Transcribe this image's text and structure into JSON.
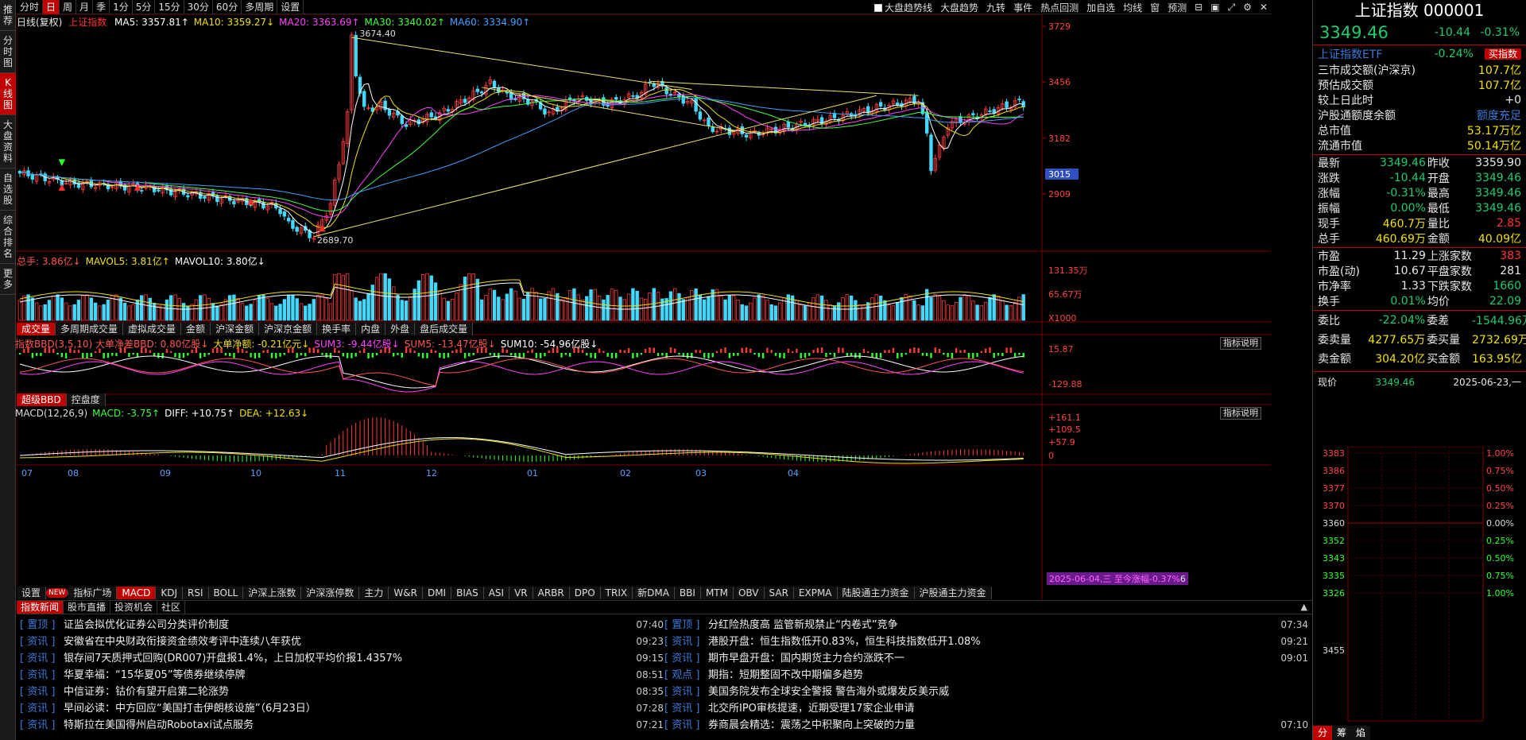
{
  "left_tabs": [
    "推荐",
    "分时图",
    "K线图",
    "大盘资料",
    "自选股",
    "综合排名",
    "更多"
  ],
  "left_active": 2,
  "toolbar": {
    "periods": [
      "分时",
      "日",
      "周",
      "月",
      "季",
      "1分",
      "5分",
      "15分",
      "30分",
      "60分",
      "多周期",
      "设置"
    ],
    "active": 1,
    "right": [
      "大盘趋势线",
      "大盘趋势",
      "九转",
      "事件",
      "热点回测",
      "加自选",
      "均线",
      "窗",
      "预测"
    ],
    "window_controls": [
      "⊟",
      "▣",
      "⤢",
      "⚙",
      "✕"
    ]
  },
  "kline": {
    "header": "日线(复权)",
    "name": "上证指数",
    "ma": [
      {
        "l": "MA5: 3357.81↑",
        "c": "#ffffff"
      },
      {
        "l": "MA10: 3359.27↓",
        "c": "#f0e000"
      },
      {
        "l": "MA20: 3363.69↑",
        "c": "#ff40ff"
      },
      {
        "l": "MA30: 3340.02↑",
        "c": "#40ff40"
      },
      {
        "l": "MA60: 3334.90↑",
        "c": "#40a0ff"
      }
    ],
    "yticks": [
      "3729",
      "3456",
      "3182",
      "2909"
    ],
    "current_label": "3015",
    "high_label": "3674.40",
    "low_label": "2689.70"
  },
  "volume": {
    "header": [
      {
        "l": "总手: 3.86亿↓",
        "c": "#ff5555"
      },
      {
        "l": "MAVOL5: 3.81亿↑",
        "c": "#f0e000"
      },
      {
        "l": "MAVOL10: 3.80亿↓",
        "c": "#ffffff"
      }
    ],
    "yticks": [
      "131.35万",
      "65.67万",
      "X1000"
    ],
    "tabs": [
      "成交量",
      "多周期成交量",
      "虚拟成交量",
      "金额",
      "沪深金额",
      "沪深京金额",
      "换手率",
      "内盘",
      "外盘",
      "盘后成交量"
    ]
  },
  "bbd": {
    "header": [
      {
        "l": "指数BBD(3,5,10) 大单净差BBD: 0.80亿股↓",
        "c": "#ff5555"
      },
      {
        "l": "大单净额: -0.21亿元↓",
        "c": "#f0e000"
      },
      {
        "l": "SUM3: -9.44亿股↓",
        "c": "#ff40ff"
      },
      {
        "l": "SUM5: -13.47亿股↓",
        "c": "#ff5555"
      },
      {
        "l": "SUM10: -54.96亿股↓",
        "c": "#ffffff"
      }
    ],
    "yticks": [
      "15.87",
      "-129.88"
    ],
    "explain": "指标说明",
    "tabs": [
      "超级BBD",
      "控盘度"
    ]
  },
  "macd": {
    "header": [
      {
        "l": "MACD(12,26,9)",
        "c": "#dddddd"
      },
      {
        "l": "MACD: -3.75↑",
        "c": "#40ff40"
      },
      {
        "l": "DIFF: +10.75↑",
        "c": "#ffffff"
      },
      {
        "l": "DEA: +12.63↓",
        "c": "#f0e000"
      }
    ],
    "yticks": [
      "+161.1",
      "+109.5",
      "+57.9",
      "0"
    ],
    "explain": "指标说明",
    "months": [
      "07",
      "08",
      "09",
      "10",
      "11",
      "12",
      "01",
      "02",
      "03",
      "04"
    ],
    "tooltip": "2025-06-04,三 至今涨幅-0.37%",
    "tooltip_tail": "6"
  },
  "indicator_tabs": [
    "设置",
    "指标广场",
    "MACD",
    "KDJ",
    "RSI",
    "BOLL",
    "沪深上涨数",
    "沪深涨停数",
    "主力",
    "W&R",
    "DMI",
    "BIAS",
    "ASI",
    "VR",
    "ARBR",
    "DPO",
    "TRIX",
    "新DMA",
    "BBI",
    "MTM",
    "OBV",
    "SAR",
    "EXPMA",
    "陆股通主力资金",
    "沪股通主力资金"
  ],
  "indicator_new": "NEW",
  "news": {
    "tabs": [
      "指数新闻",
      "股市直播",
      "投资机会",
      "社区"
    ],
    "left": [
      {
        "tag": "[ 置顶 ]",
        "text": "证监会拟优化证券公司分类评价制度",
        "time": "07:40"
      },
      {
        "tag": "[ 资讯 ]",
        "text": "安徽省在中央财政衔接资金绩效考评中连续八年获优",
        "time": "09:23"
      },
      {
        "tag": "[ 资讯 ]",
        "text": "银存间7天质押式回购(DR007)开盘报1.4%，上日加权平均价报1.4357%",
        "time": "09:15"
      },
      {
        "tag": "[ 资讯 ]",
        "text": "华夏幸福：“15华夏05”等债券继续停牌",
        "time": "08:51"
      },
      {
        "tag": "[ 资讯 ]",
        "text": "中信证券：钴价有望开启第二轮涨势",
        "time": "08:35"
      },
      {
        "tag": "[ 资讯 ]",
        "text": "早间必读：中方回应“美国打击伊朗核设施”（6月23日）",
        "time": "07:28"
      },
      {
        "tag": "[ 资讯 ]",
        "text": "特斯拉在美国得州启动Robotaxi试点服务",
        "time": "07:21"
      }
    ],
    "right": [
      {
        "tag": "[ 置顶 ]",
        "text": "分红险热度高 监管新规禁止“内卷式”竞争",
        "time": "07:34"
      },
      {
        "tag": "[ 资讯 ]",
        "text": "港股开盘：恒生指数低开0.83%，恒生科技指数低开1.08%",
        "time": "09:21"
      },
      {
        "tag": "[ 资讯 ]",
        "text": "期市早盘开盘：国内期货主力合约涨跌不一",
        "time": "09:01"
      },
      {
        "tag": "[ 观点 ]",
        "text": "期指：短期整固不改中期偏多趋势",
        "time": ""
      },
      {
        "tag": "[ 资讯 ]",
        "text": "美国务院发布全球安全警报 警告海外或爆发反美示威",
        "time": ""
      },
      {
        "tag": "[ 资讯 ]",
        "text": "北交所IPO审核提速，近期受理17家企业申请",
        "time": ""
      },
      {
        "tag": "[ 资讯 ]",
        "text": "券商晨会精选：震荡之中积聚向上突破的力量",
        "time": "07:10"
      }
    ]
  },
  "quote": {
    "title": "上证指数 000001",
    "price": "3349.46",
    "change": "-10.44",
    "pct": "-0.31%",
    "etf": {
      "name": "上证指数ETF",
      "pct": "-0.24%",
      "btn": "买指数"
    },
    "list1": [
      [
        "三市成交额(沪深京)",
        "107.7亿"
      ],
      [
        "预估成交额",
        "107.7亿"
      ],
      [
        "较上日此时",
        "+0"
      ],
      [
        "沪股通额度余额",
        "额度充足"
      ],
      [
        "总市值",
        "53.17万亿"
      ],
      [
        "流通市值",
        "50.14万亿"
      ]
    ],
    "grid": [
      [
        "最新",
        "3349.46",
        "昨收",
        "3359.90"
      ],
      [
        "涨跌",
        "-10.44",
        "开盘",
        "3349.46"
      ],
      [
        "涨幅",
        "-0.31%",
        "最高",
        "3349.46"
      ],
      [
        "振幅",
        "0.00%",
        "最低",
        "3349.46"
      ],
      [
        "现手",
        "460.7万",
        "量比",
        "2.85"
      ],
      [
        "总手",
        "460.69万",
        "金额",
        "40.09亿"
      ]
    ],
    "grid2": [
      [
        "市盈",
        "11.29",
        "上涨家数",
        "383"
      ],
      [
        "市盈(动)",
        "10.67",
        "平盘家数",
        "281"
      ],
      [
        "市净率",
        "1.33",
        "下跌家数",
        "1660"
      ],
      [
        "换手",
        "0.01%",
        "均价",
        "22.09"
      ]
    ],
    "wb": [
      [
        "委比",
        "-22.04%",
        "委差",
        "-1544.96万"
      ],
      [
        "委卖量",
        "4277.65万",
        "委买量",
        "2732.69万"
      ],
      [
        "卖金额",
        "304.20亿",
        "买金额",
        "163.95亿"
      ]
    ],
    "now": {
      "label": "现价",
      "price": "3349.46",
      "date": "2025-06-23,一"
    },
    "mini_left": [
      "3383",
      "3386",
      "3377",
      "3370",
      "3360",
      "3352",
      "3343",
      "3335",
      "3326",
      "3455"
    ],
    "mini_right": [
      "1.00%",
      "0.75%",
      "0.50%",
      "0.25%",
      "0.00%",
      "0.25%",
      "0.50%",
      "0.75%",
      "1.00%"
    ],
    "bottom_tabs": [
      "分",
      "筹",
      "焰"
    ]
  }
}
